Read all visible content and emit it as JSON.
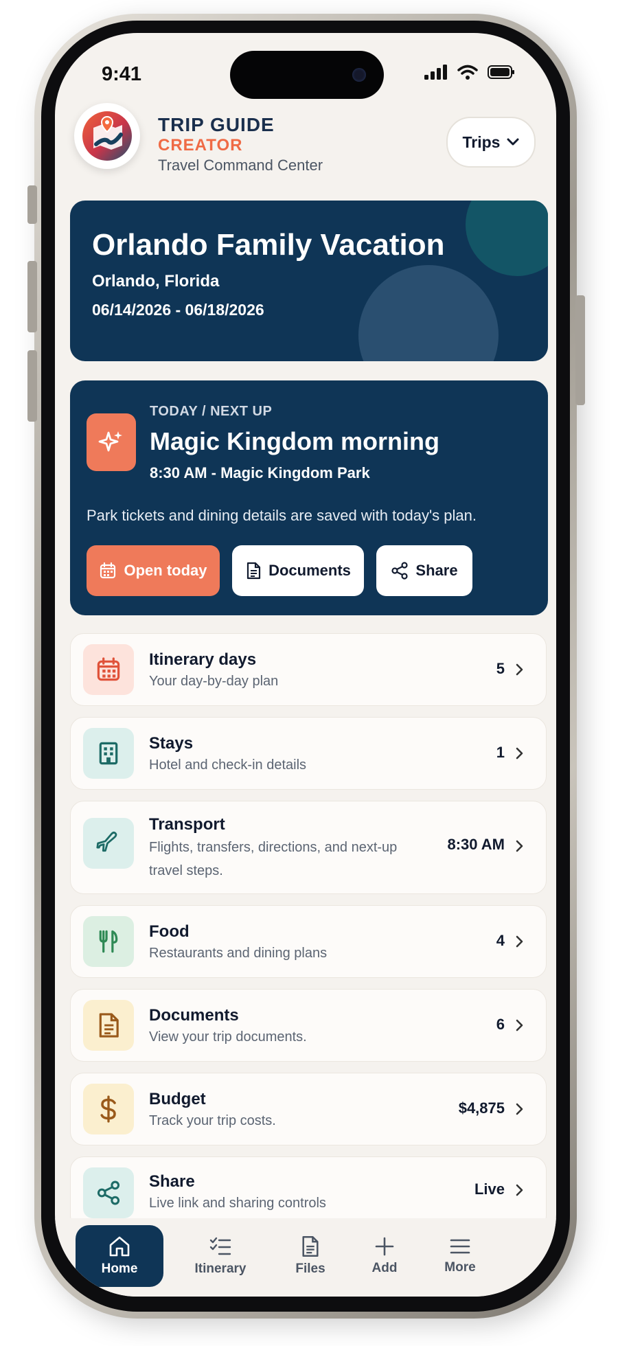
{
  "status_bar": {
    "time": "9:41"
  },
  "header": {
    "brand_line1": "TRIP GUIDE",
    "brand_line2": "CREATOR",
    "tagline": "Travel Command Center",
    "trips_button": "Trips"
  },
  "trip": {
    "title": "Orlando Family Vacation",
    "location": "Orlando, Florida",
    "dates": "06/14/2026 - 06/18/2026"
  },
  "next_up": {
    "eyebrow": "TODAY / NEXT UP",
    "title": "Magic Kingdom morning",
    "time_place": "8:30 AM - Magic Kingdom Park",
    "description": "Park tickets and dining details are saved with today's plan.",
    "buttons": {
      "open_today": "Open today",
      "documents": "Documents",
      "share": "Share"
    }
  },
  "sections": [
    {
      "title": "Itinerary days",
      "subtitle": "Your day-by-day plan",
      "value": "5",
      "icon": "calendar-icon"
    },
    {
      "title": "Stays",
      "subtitle": "Hotel and check-in details",
      "value": "1",
      "icon": "building-icon"
    },
    {
      "title": "Transport",
      "subtitle": "Flights, transfers, directions, and next-up",
      "subtitle2": "travel steps.",
      "value": "8:30 AM",
      "icon": "plane-icon"
    },
    {
      "title": "Food",
      "subtitle": "Restaurants and dining plans",
      "value": "4",
      "icon": "utensils-icon"
    },
    {
      "title": "Documents",
      "subtitle": "View your trip documents.",
      "value": "6",
      "icon": "document-icon"
    },
    {
      "title": "Budget",
      "subtitle": "Track your trip costs.",
      "value": "$4,875",
      "icon": "dollar-icon"
    },
    {
      "title": "Share",
      "subtitle": "Live link and sharing controls",
      "value": "Live",
      "icon": "share-icon"
    }
  ],
  "bottom_nav": [
    {
      "label": "Home",
      "icon": "home-icon",
      "active": true
    },
    {
      "label": "Itinerary",
      "icon": "checklist-icon"
    },
    {
      "label": "Files",
      "icon": "file-icon"
    },
    {
      "label": "Add",
      "icon": "plus-icon"
    },
    {
      "label": "More",
      "icon": "menu-icon"
    }
  ],
  "colors": {
    "navy": "#0f3556",
    "accent_orange": "#ef7a5a",
    "background": "#f5f2ee"
  }
}
